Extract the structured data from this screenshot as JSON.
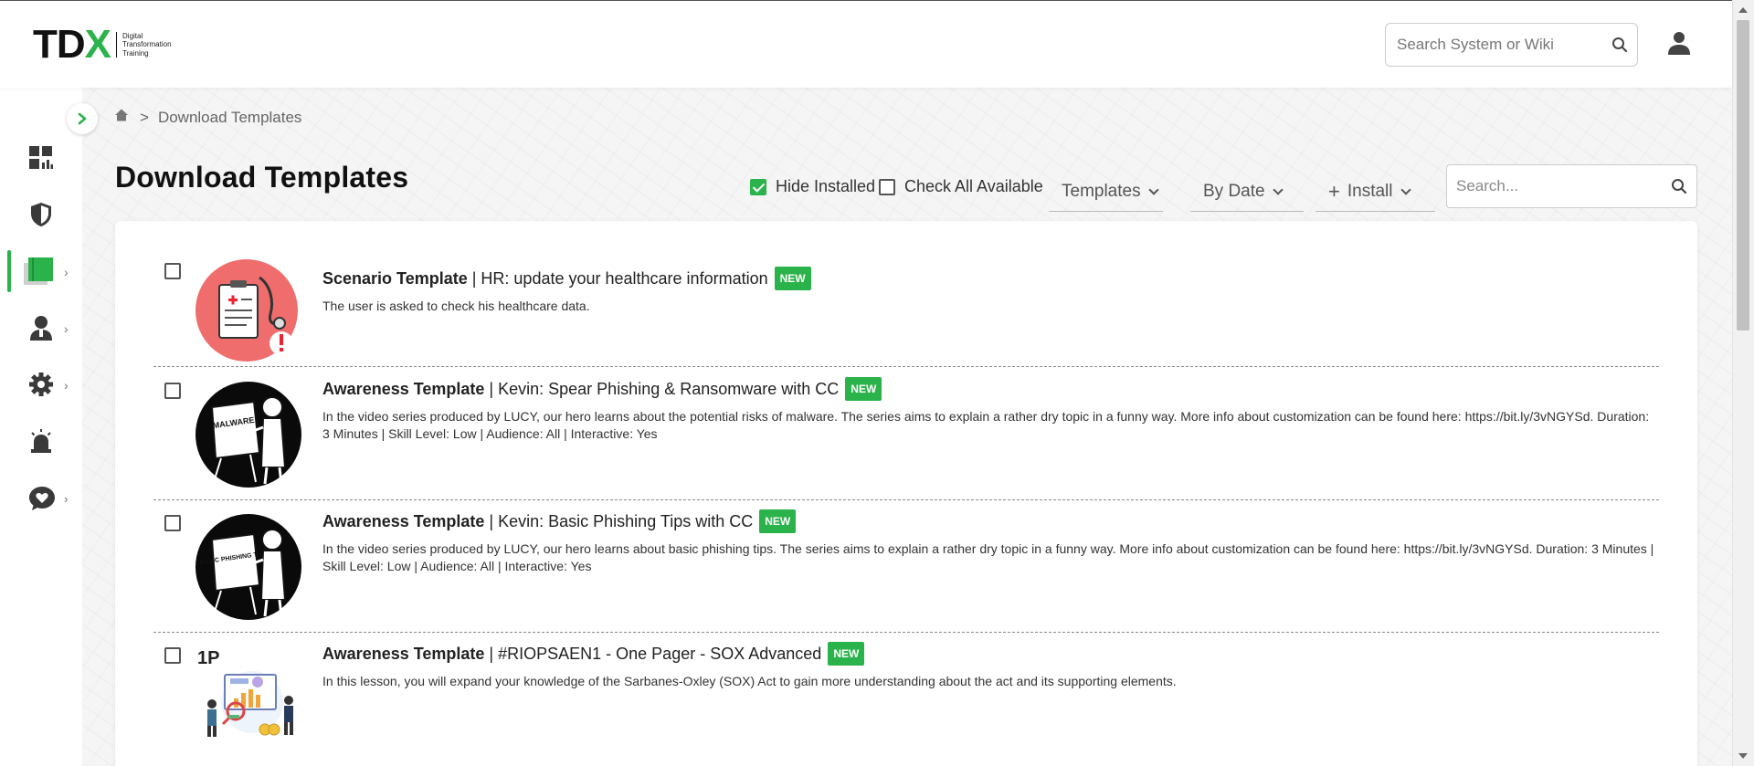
{
  "header": {
    "logo_text_a": "TD",
    "logo_text_b": "X",
    "logo_tagline": [
      "Digital",
      "Transformation",
      "Training"
    ],
    "search_placeholder": "Search System or Wiki"
  },
  "colors": {
    "accent": "#2bb34b",
    "divider": "#888888"
  },
  "sidebar": {
    "items": [
      {
        "icon": "dashboard-icon",
        "has_chevron": false
      },
      {
        "icon": "shield-icon",
        "has_chevron": false
      },
      {
        "icon": "templates-book-icon",
        "has_chevron": true,
        "active": true
      },
      {
        "icon": "users-icon",
        "has_chevron": true
      },
      {
        "icon": "gear-icon",
        "has_chevron": true
      },
      {
        "icon": "alarm-icon",
        "has_chevron": false
      },
      {
        "icon": "heart-chat-icon",
        "has_chevron": true
      }
    ]
  },
  "breadcrumb": {
    "separator": ">",
    "current": "Download Templates"
  },
  "page": {
    "title": "Download Templates"
  },
  "toolbar": {
    "hide_installed_label": "Hide Installed",
    "hide_installed_checked": true,
    "check_all_label": "Check All Available",
    "check_all_checked": false,
    "filter_templates": "Templates",
    "sort_by": "By Date",
    "install_label": "Install",
    "search_placeholder": "Search..."
  },
  "templates": [
    {
      "type": "Scenario Template",
      "name": "HR: update your healthcare information",
      "badge": "NEW",
      "description": "The user is asked to check his healthcare data.",
      "thumb": "healthcare-clipboard"
    },
    {
      "type": "Awareness Template",
      "name": "Kevin: Spear Phishing & Ransomware with CC",
      "badge": "NEW",
      "description": "In the video series produced by LUCY, our hero learns about the potential risks of malware. The series aims to explain a rather dry topic in a funny way. More info about customization can be found here: https://bit.ly/3vNGYSd. Duration: 3 Minutes | Skill Level: Low | Audience: All | Interactive: Yes",
      "thumb": "kevin-malware",
      "board_text": "MALWARE"
    },
    {
      "type": "Awareness Template",
      "name": "Kevin: Basic Phishing Tips with CC",
      "badge": "NEW",
      "description": "In the video series produced by LUCY, our hero learns about basic phishing tips. The series aims to explain a rather dry topic in a funny way. More info about customization can be found here: https://bit.ly/3vNGYSd. Duration: 3 Minutes | Skill Level: Low | Audience: All | Interactive: Yes",
      "thumb": "kevin-phishing",
      "board_text": "BASIC PHISHING TIPS"
    },
    {
      "type": "Awareness Template",
      "name": "#RIOPSAEN1 - One Pager - SOX Advanced",
      "badge": "NEW",
      "description": "In this lesson, you will expand your knowledge of the Sarbanes-Oxley (SOX) Act to gain more understanding about the act and its supporting elements.",
      "thumb": "one-pager",
      "thumb_label": "1P"
    }
  ]
}
